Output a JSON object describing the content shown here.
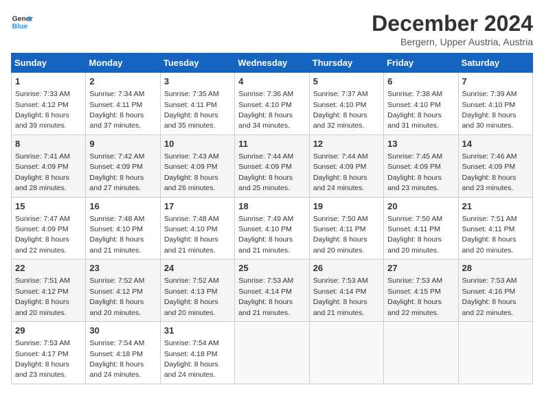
{
  "header": {
    "logo_line1": "General",
    "logo_line2": "Blue",
    "month": "December 2024",
    "location": "Bergern, Upper Austria, Austria"
  },
  "weekdays": [
    "Sunday",
    "Monday",
    "Tuesday",
    "Wednesday",
    "Thursday",
    "Friday",
    "Saturday"
  ],
  "weeks": [
    [
      {
        "day": "1",
        "sunrise": "7:33 AM",
        "sunset": "4:12 PM",
        "daylight": "8 hours and 39 minutes."
      },
      {
        "day": "2",
        "sunrise": "7:34 AM",
        "sunset": "4:11 PM",
        "daylight": "8 hours and 37 minutes."
      },
      {
        "day": "3",
        "sunrise": "7:35 AM",
        "sunset": "4:11 PM",
        "daylight": "8 hours and 35 minutes."
      },
      {
        "day": "4",
        "sunrise": "7:36 AM",
        "sunset": "4:10 PM",
        "daylight": "8 hours and 34 minutes."
      },
      {
        "day": "5",
        "sunrise": "7:37 AM",
        "sunset": "4:10 PM",
        "daylight": "8 hours and 32 minutes."
      },
      {
        "day": "6",
        "sunrise": "7:38 AM",
        "sunset": "4:10 PM",
        "daylight": "8 hours and 31 minutes."
      },
      {
        "day": "7",
        "sunrise": "7:39 AM",
        "sunset": "4:10 PM",
        "daylight": "8 hours and 30 minutes."
      }
    ],
    [
      {
        "day": "8",
        "sunrise": "7:41 AM",
        "sunset": "4:09 PM",
        "daylight": "8 hours and 28 minutes."
      },
      {
        "day": "9",
        "sunrise": "7:42 AM",
        "sunset": "4:09 PM",
        "daylight": "8 hours and 27 minutes."
      },
      {
        "day": "10",
        "sunrise": "7:43 AM",
        "sunset": "4:09 PM",
        "daylight": "8 hours and 26 minutes."
      },
      {
        "day": "11",
        "sunrise": "7:44 AM",
        "sunset": "4:09 PM",
        "daylight": "8 hours and 25 minutes."
      },
      {
        "day": "12",
        "sunrise": "7:44 AM",
        "sunset": "4:09 PM",
        "daylight": "8 hours and 24 minutes."
      },
      {
        "day": "13",
        "sunrise": "7:45 AM",
        "sunset": "4:09 PM",
        "daylight": "8 hours and 23 minutes."
      },
      {
        "day": "14",
        "sunrise": "7:46 AM",
        "sunset": "4:09 PM",
        "daylight": "8 hours and 23 minutes."
      }
    ],
    [
      {
        "day": "15",
        "sunrise": "7:47 AM",
        "sunset": "4:09 PM",
        "daylight": "8 hours and 22 minutes."
      },
      {
        "day": "16",
        "sunrise": "7:48 AM",
        "sunset": "4:10 PM",
        "daylight": "8 hours and 21 minutes."
      },
      {
        "day": "17",
        "sunrise": "7:48 AM",
        "sunset": "4:10 PM",
        "daylight": "8 hours and 21 minutes."
      },
      {
        "day": "18",
        "sunrise": "7:49 AM",
        "sunset": "4:10 PM",
        "daylight": "8 hours and 21 minutes."
      },
      {
        "day": "19",
        "sunrise": "7:50 AM",
        "sunset": "4:11 PM",
        "daylight": "8 hours and 20 minutes."
      },
      {
        "day": "20",
        "sunrise": "7:50 AM",
        "sunset": "4:11 PM",
        "daylight": "8 hours and 20 minutes."
      },
      {
        "day": "21",
        "sunrise": "7:51 AM",
        "sunset": "4:11 PM",
        "daylight": "8 hours and 20 minutes."
      }
    ],
    [
      {
        "day": "22",
        "sunrise": "7:51 AM",
        "sunset": "4:12 PM",
        "daylight": "8 hours and 20 minutes."
      },
      {
        "day": "23",
        "sunrise": "7:52 AM",
        "sunset": "4:12 PM",
        "daylight": "8 hours and 20 minutes."
      },
      {
        "day": "24",
        "sunrise": "7:52 AM",
        "sunset": "4:13 PM",
        "daylight": "8 hours and 20 minutes."
      },
      {
        "day": "25",
        "sunrise": "7:53 AM",
        "sunset": "4:14 PM",
        "daylight": "8 hours and 21 minutes."
      },
      {
        "day": "26",
        "sunrise": "7:53 AM",
        "sunset": "4:14 PM",
        "daylight": "8 hours and 21 minutes."
      },
      {
        "day": "27",
        "sunrise": "7:53 AM",
        "sunset": "4:15 PM",
        "daylight": "8 hours and 22 minutes."
      },
      {
        "day": "28",
        "sunrise": "7:53 AM",
        "sunset": "4:16 PM",
        "daylight": "8 hours and 22 minutes."
      }
    ],
    [
      {
        "day": "29",
        "sunrise": "7:53 AM",
        "sunset": "4:17 PM",
        "daylight": "8 hours and 23 minutes."
      },
      {
        "day": "30",
        "sunrise": "7:54 AM",
        "sunset": "4:18 PM",
        "daylight": "8 hours and 24 minutes."
      },
      {
        "day": "31",
        "sunrise": "7:54 AM",
        "sunset": "4:18 PM",
        "daylight": "8 hours and 24 minutes."
      },
      null,
      null,
      null,
      null
    ]
  ]
}
